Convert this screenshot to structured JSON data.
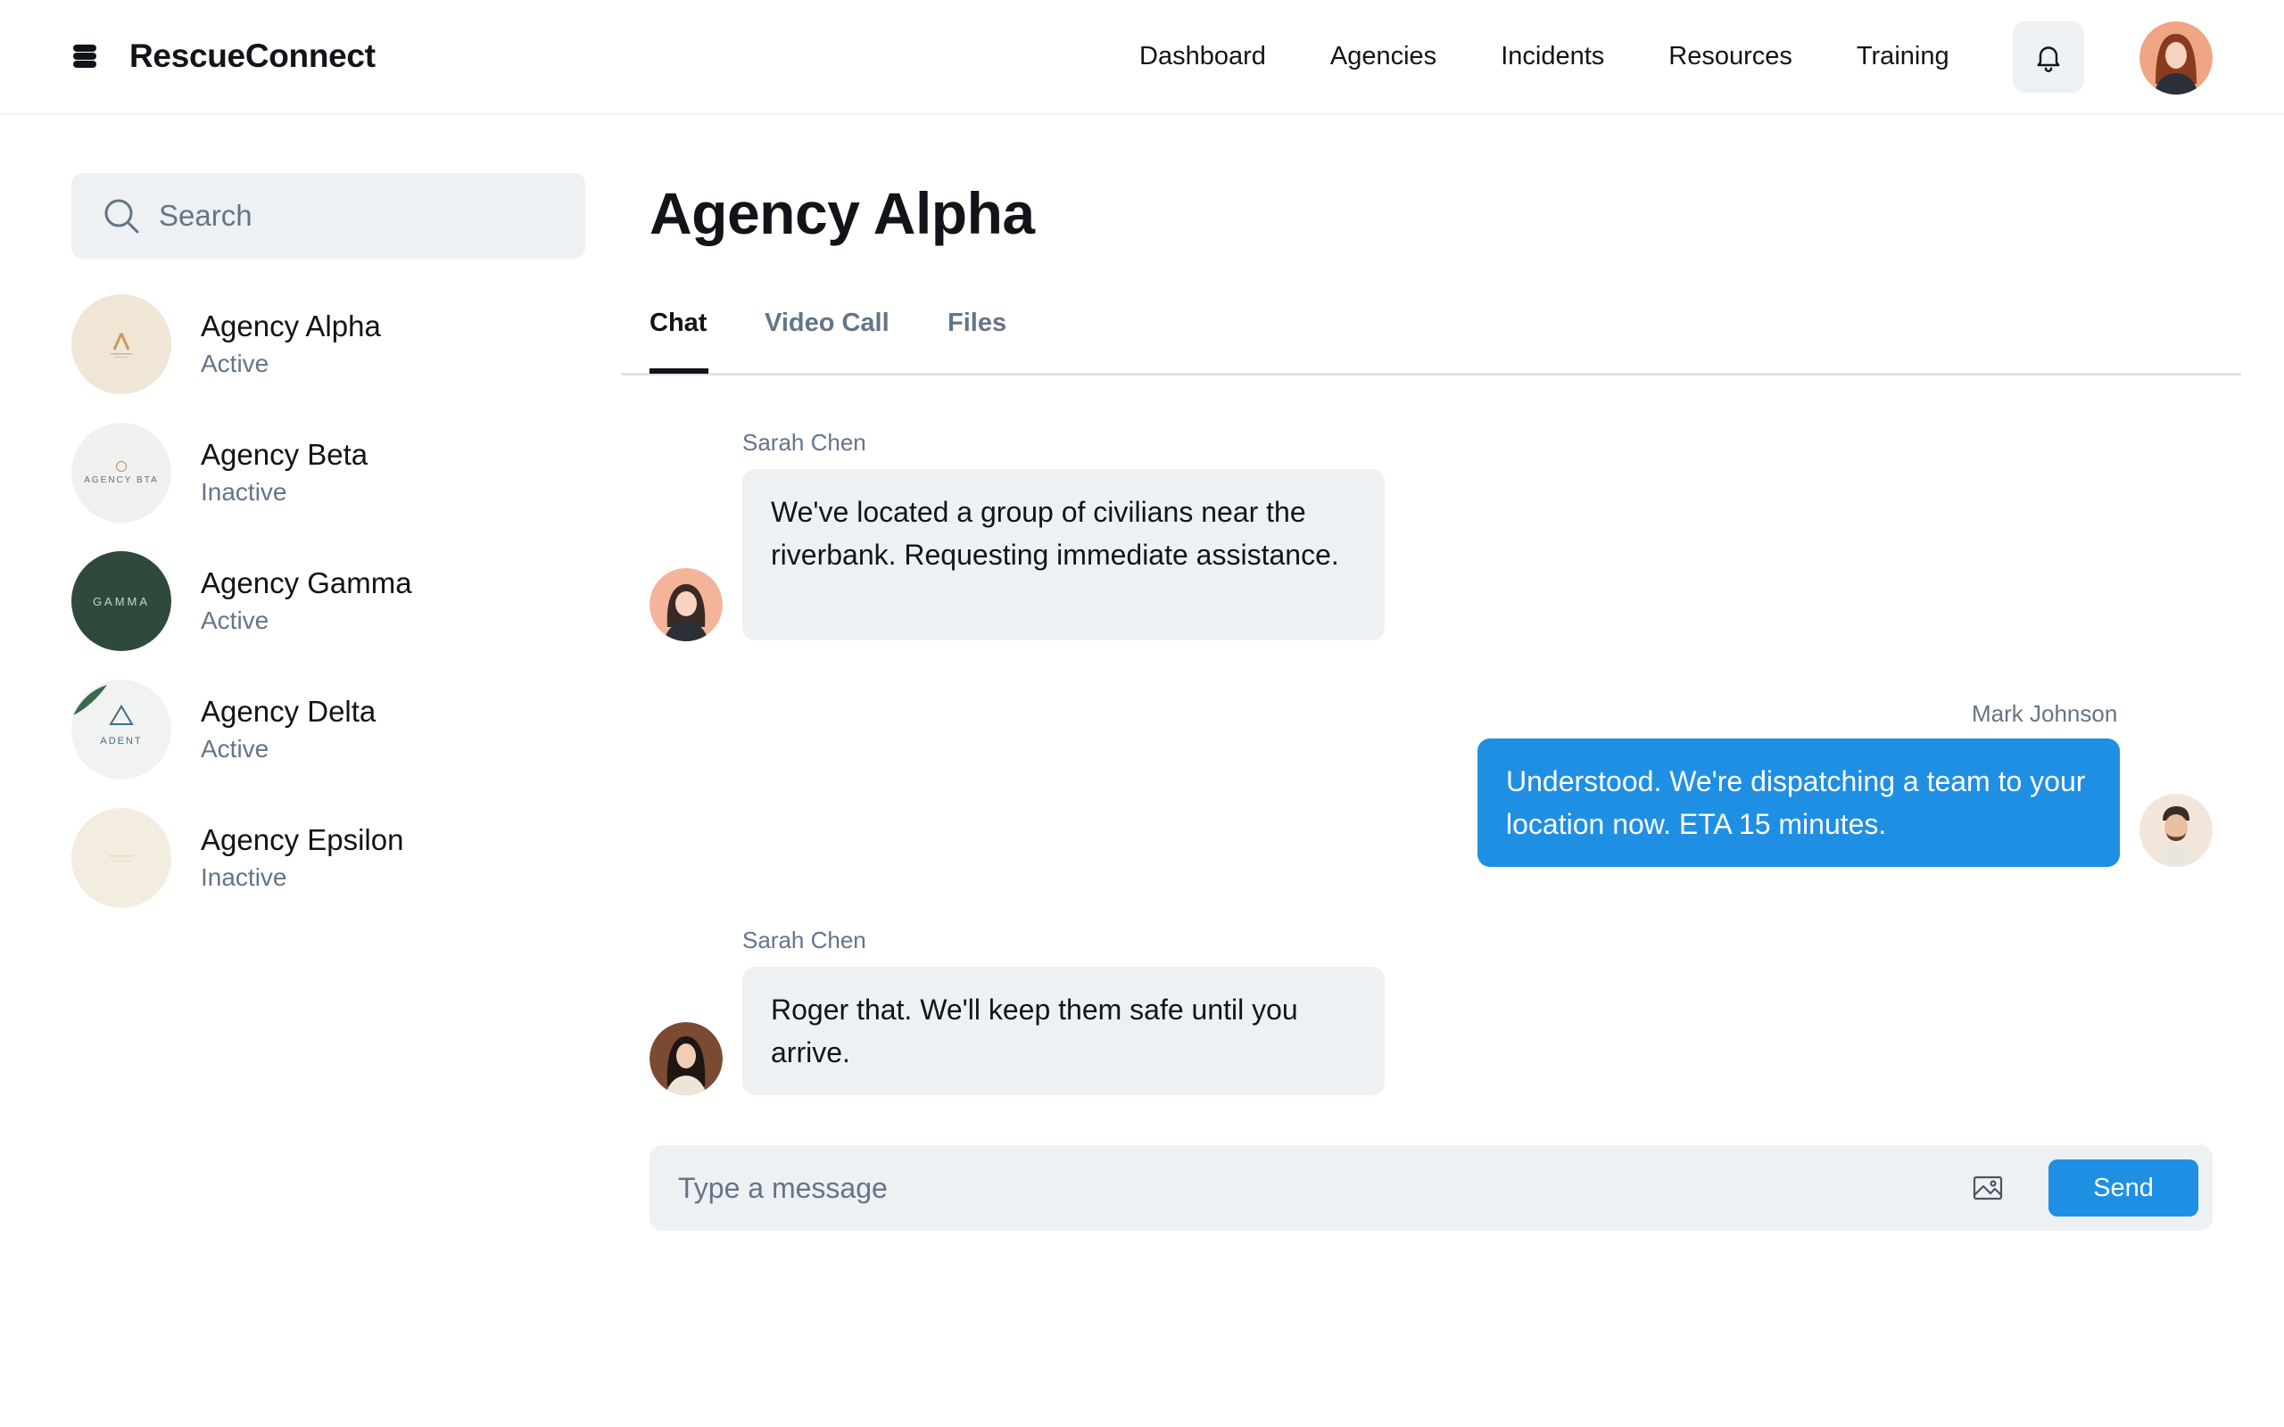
{
  "app": {
    "name": "RescueConnect"
  },
  "nav": {
    "items": [
      "Dashboard",
      "Agencies",
      "Incidents",
      "Resources",
      "Training"
    ]
  },
  "search": {
    "placeholder": "Search"
  },
  "agencies": [
    {
      "name": "Agency Alpha",
      "status": "Active"
    },
    {
      "name": "Agency Beta",
      "status": "Inactive",
      "logo_text": "AGENCY BTA"
    },
    {
      "name": "Agency Gamma",
      "status": "Active",
      "logo_text": "GAMMA"
    },
    {
      "name": "Agency Delta",
      "status": "Active",
      "logo_text": "ADENT"
    },
    {
      "name": "Agency Epsilon",
      "status": "Inactive"
    }
  ],
  "chat": {
    "title": "Agency Alpha",
    "tabs": [
      "Chat",
      "Video Call",
      "Files"
    ],
    "active_tab": "Chat",
    "messages": [
      {
        "sender": "Sarah Chen",
        "direction": "incoming",
        "text": "We've located a group of civilians near the riverbank. Requesting immediate assistance."
      },
      {
        "sender": "Mark Johnson",
        "direction": "outgoing",
        "text": "Understood. We're dispatching a team to your location now. ETA 15 minutes."
      },
      {
        "sender": "Sarah Chen",
        "direction": "incoming",
        "text": "Roger that. We'll keep them safe until you arrive."
      }
    ]
  },
  "composer": {
    "placeholder": "Type a message",
    "send_label": "Send"
  },
  "colors": {
    "accent": "#1f8fe3",
    "surface": "#eef1f3",
    "muted_text": "#637588"
  }
}
